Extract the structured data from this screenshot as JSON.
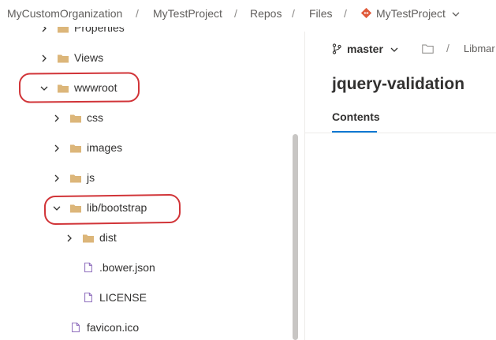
{
  "breadcrumb": {
    "organization": "MyCustomOrganization",
    "project": "MyTestProject",
    "repos": "Repos",
    "files": "Files",
    "repository": "MyTestProject",
    "separator": "/"
  },
  "tree": {
    "items": [
      {
        "label": "Properties",
        "type": "folder",
        "state": "collapsed"
      },
      {
        "label": "Views",
        "type": "folder",
        "state": "collapsed"
      },
      {
        "label": "wwwroot",
        "type": "folder",
        "state": "expanded"
      },
      {
        "label": "css",
        "type": "folder",
        "state": "collapsed"
      },
      {
        "label": "images",
        "type": "folder",
        "state": "collapsed"
      },
      {
        "label": "js",
        "type": "folder",
        "state": "collapsed"
      },
      {
        "label": "lib/bootstrap",
        "type": "folder",
        "state": "expanded"
      },
      {
        "label": "dist",
        "type": "folder",
        "state": "collapsed"
      },
      {
        "label": ".bower.json",
        "type": "file"
      },
      {
        "label": "LICENSE",
        "type": "file"
      },
      {
        "label": "favicon.ico",
        "type": "file"
      }
    ]
  },
  "branch": {
    "name": "master",
    "path_separator": "/",
    "path_item": "Libmar"
  },
  "content": {
    "title": "jquery-validation",
    "tab": "Contents"
  },
  "colors": {
    "folder": "#dcb67a",
    "highlight": "#d13438",
    "accent": "#0078d4",
    "repo_icon": "#e05a3a"
  }
}
